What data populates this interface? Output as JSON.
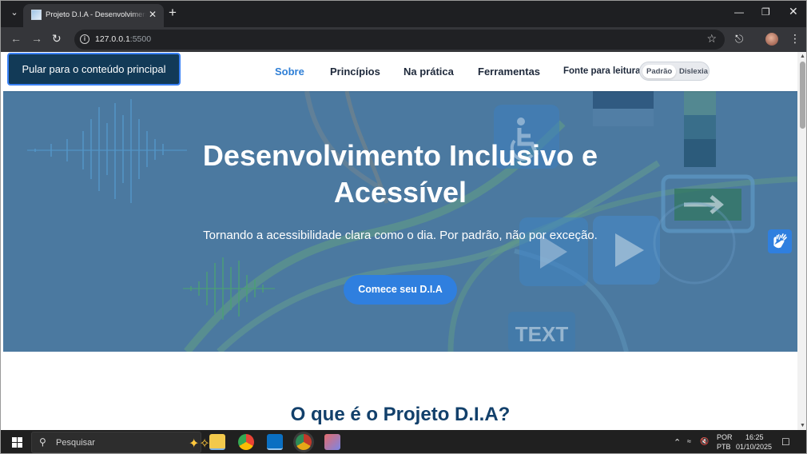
{
  "browser": {
    "tab_title": "Projeto D.I.A - Desenvolvimento Inclusivo e Acessível",
    "url_host": "127.0.0.1",
    "url_port": ":5500"
  },
  "header": {
    "skip_link": "Pular para o conteúdo principal",
    "nav": [
      "Sobre",
      "Princípios",
      "Na prática",
      "Ferramentas"
    ],
    "active_nav": "Sobre",
    "font_label": "Fonte para leitura",
    "font_options": [
      "Padrão",
      "Dislexia"
    ],
    "font_selected": "Padrão"
  },
  "hero": {
    "title_line1": "Desenvolvimento Inclusivo e",
    "title_line2": "Acessível",
    "subtitle": "Tornando a acessibilidade clara como o dia. Por padrão, não por exceção.",
    "cta": "Comece seu D.I.A",
    "image_text": "TEXT"
  },
  "section": {
    "title": "O que é o Projeto D.I.A?"
  },
  "taskbar": {
    "search_placeholder": "Pesquisar",
    "lang_top": "POR",
    "lang_bottom": "PTB",
    "time": "16:25",
    "date": "01/10/2025"
  },
  "icons": {
    "accessibility": "vlibras-hands-icon",
    "start": "windows-start-icon"
  },
  "colors": {
    "accent": "#2f7fdf",
    "heading": "#12406b",
    "skip_bg": "#123a57",
    "hero_overlay": "#4f7ca2"
  }
}
